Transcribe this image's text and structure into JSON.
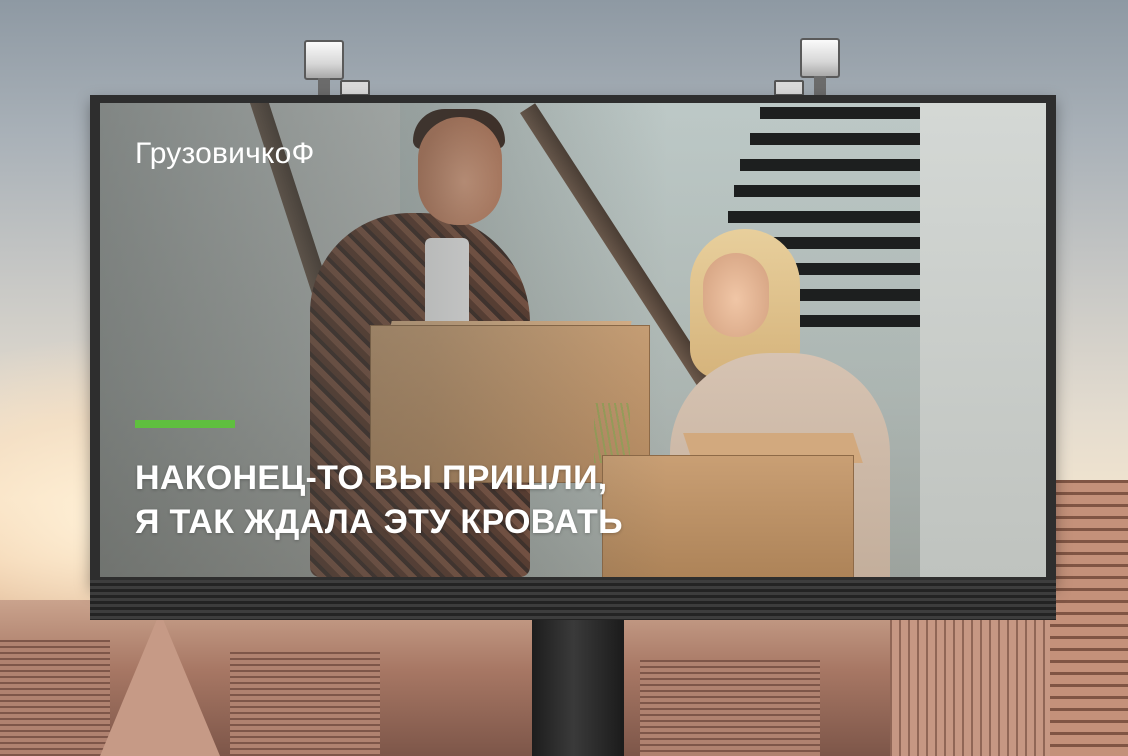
{
  "billboard": {
    "brand": "ГрузовичкоФ",
    "headline_line1": "НАКОНЕЦ-ТО ВЫ ПРИШЛИ,",
    "headline_line2": "Я ТАК ЖДАЛА ЭТУ КРОВАТЬ",
    "accent_color": "#5fbf3f",
    "text_color": "#ffffff"
  }
}
